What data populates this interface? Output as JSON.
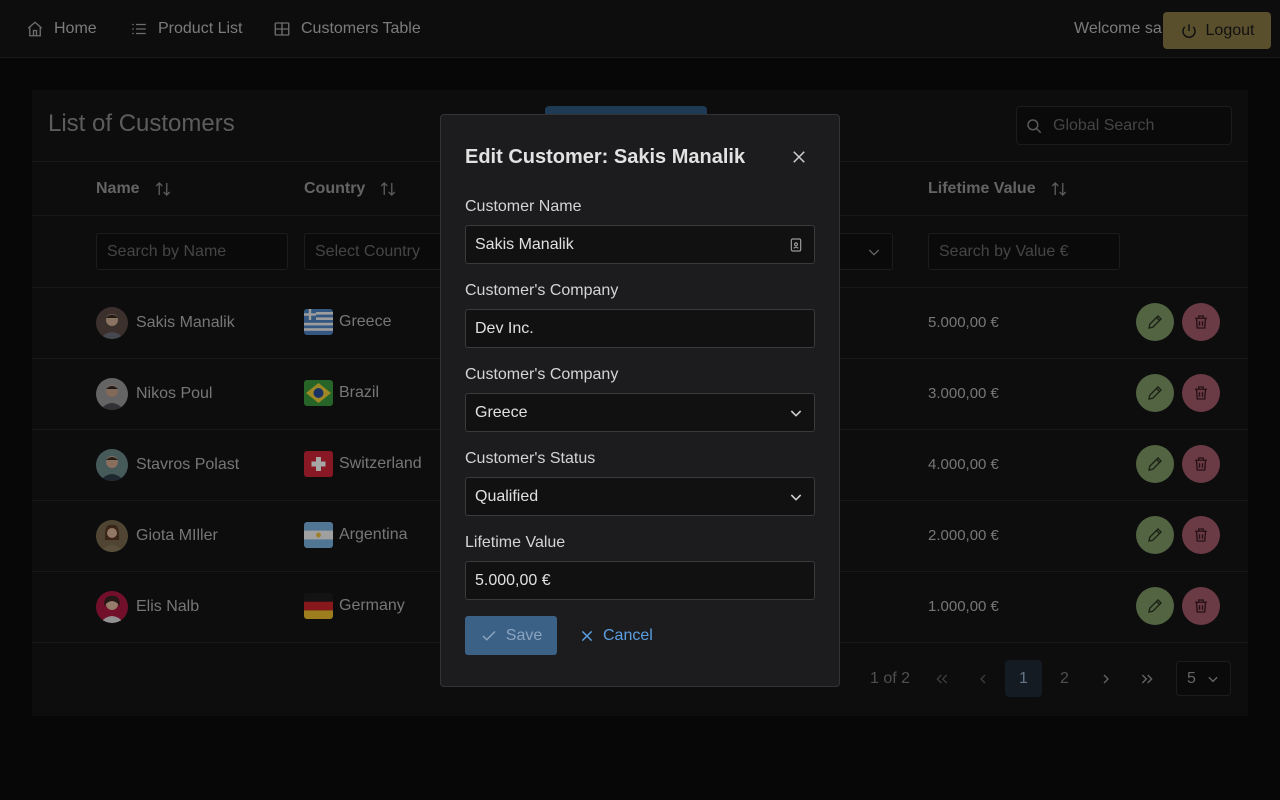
{
  "nav": {
    "home": "Home",
    "products": "Product List",
    "customers": "Customers Table",
    "welcome": "Welcome sa",
    "logout": "Logout"
  },
  "card": {
    "title": "List of Customers",
    "global_search_placeholder": "Global Search"
  },
  "columns": {
    "name": "Name",
    "country": "Country",
    "value": "Lifetime Value"
  },
  "filters": {
    "name_placeholder": "Search by Name",
    "country_placeholder": "Select Country",
    "value_placeholder": "Search by Value €"
  },
  "rows": [
    {
      "name": "Sakis Manalik",
      "country": "Greece",
      "value": "5.000,00 €"
    },
    {
      "name": "Nikos Poul",
      "country": "Brazil",
      "value": "3.000,00 €"
    },
    {
      "name": "Stavros Polast",
      "country": "Switzerland",
      "value": "4.000,00 €"
    },
    {
      "name": "Giota MIller",
      "country": "Argentina",
      "value": "2.000,00 €"
    },
    {
      "name": "Elis Nalb",
      "country": "Germany",
      "value": "1.000,00 €"
    }
  ],
  "paginator": {
    "report": "1 of 2",
    "page1": "1",
    "page2": "2",
    "rows_per_page": "5"
  },
  "dialog": {
    "title": "Edit Customer: Sakis Manalik",
    "name_label": "Customer Name",
    "name_value": "Sakis Manalik",
    "company_label": "Customer's Company",
    "company_value": "Dev Inc.",
    "country_label": "Customer's Company",
    "country_value": "Greece",
    "status_label": "Customer's Status",
    "status_value": "Qualified",
    "value_label": "Lifetime Value",
    "value_value": "5.000,00 €",
    "save": "Save",
    "cancel": "Cancel"
  }
}
